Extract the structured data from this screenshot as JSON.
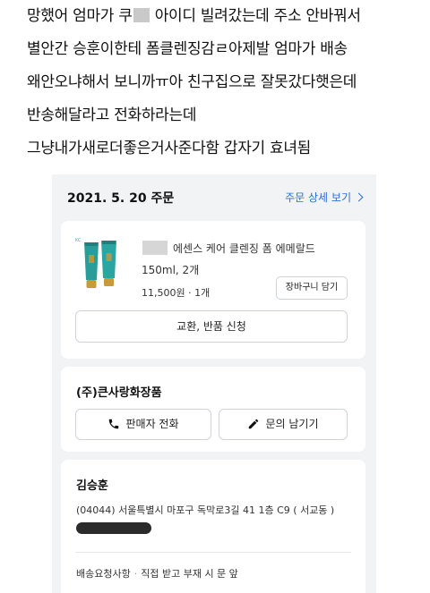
{
  "caption": {
    "line1_before": "망했어 엄마가 쿠",
    "line1_after": " 아이디 빌려갔는데 주소 안바꿔서",
    "line2": "별안간 승훈이한테 폼클렌징감ㄹ아제발 엄마가 배송",
    "line3": "왜안오냐해서 보니까ㅠ아 친구집으로 잘못갔다햇은데",
    "line4": "반송해달라고 전화하라는데",
    "line5": "그냥내가새로더좋은거사준다함 갑자기 효녀됨"
  },
  "order": {
    "date_label": "2021. 5. 20 주문",
    "detail_link": "주문 상세 보기"
  },
  "product": {
    "name": "에센스 케어 클렌징 폼 에메랄드",
    "option": "150ml, 2개",
    "price_qty": "11,500원 · 1개",
    "cart_button": "장바구니 담기",
    "return_button": "교환, 반품 신청"
  },
  "seller": {
    "name": "(주)큰사랑화장품",
    "call_button": "판매자 전화",
    "inquiry_button": "문의 남기기"
  },
  "shipping": {
    "recipient": "김승훈",
    "address": "(04044) 서울특별시 마포구 독막로3길 41 1층 C9 ( 서교동 )",
    "request_label": "배송요청사항",
    "request_value": "직접 받고 부재 시 문 앞"
  },
  "colors": {
    "link_blue": "#2f6fd8",
    "tube_teal": "#2a9d9a",
    "tube_cap": "#c99a3a",
    "page_gray": "#f2f3f5"
  },
  "icons": {
    "chevron": "chevron-right-icon",
    "phone": "phone-icon",
    "pencil": "pencil-icon"
  }
}
